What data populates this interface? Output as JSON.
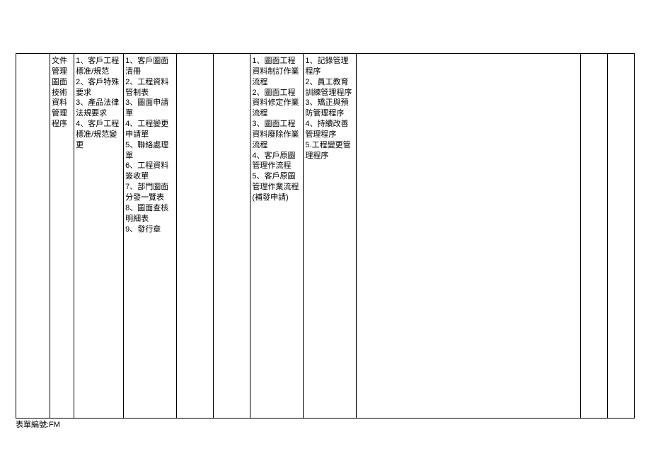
{
  "table": {
    "row": {
      "col1": "",
      "col2": "文件管理\n\n圖面技術資料管理程序",
      "col3": "1、客戶工程標准/規范\n2、客戶特殊要求\n3、產品法律法規要求\n4、客戶工程標准/規范變更",
      "col4": "1、客戶圖面清冊\n2、工程資料管制表\n3、圖面申請單\n4、工程變更申請單\n5、聯絡處理單\n6、工程資料簽收單\n7、部門圖面分發一覽表\n8、圖面查核明細表\n9、發行章",
      "col5": "",
      "col6": "",
      "col7": "1、圖面工程資料制訂作業流程\n2、圖面工程資料修定作業流程\n3、圖面工程資料廢除作業流程\n4、客戶原圖管理作流程\n5、客戶原圖管理作業流程(補發申請)",
      "col8": "1、記錄管理程序\n2、員工教育訓練管理程序\n3、矯正與預防管理程序\n4、持續改善管理程序\n5.工程變更管理程序",
      "col9": "",
      "col10": "",
      "col11": ""
    }
  },
  "footer": "表單編號:FM"
}
